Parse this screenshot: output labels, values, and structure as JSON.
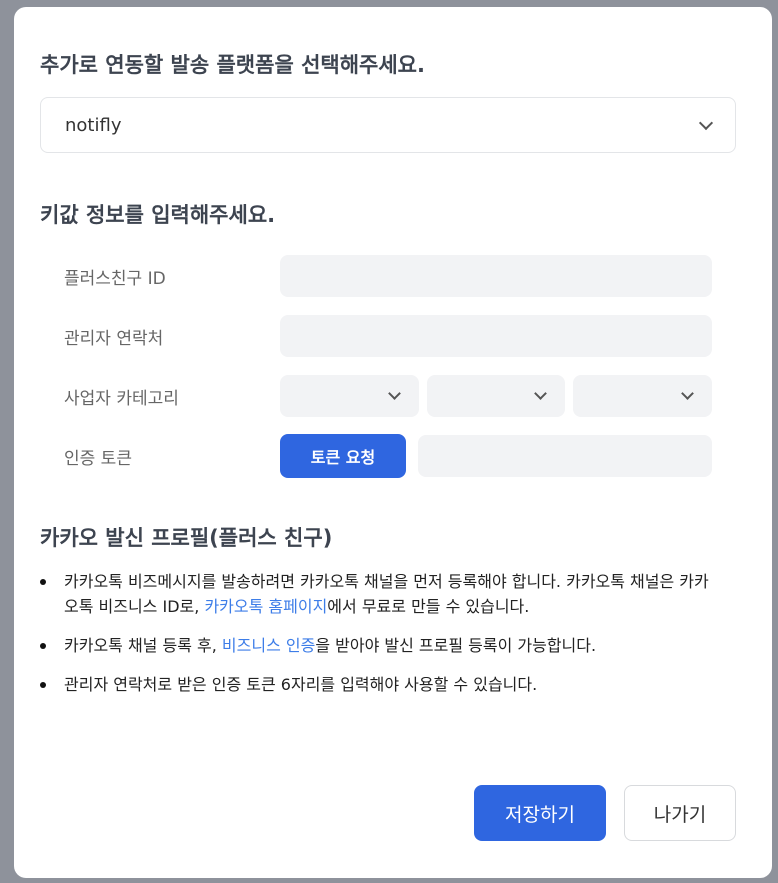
{
  "platform_section": {
    "title": "추가로 연동할 발송 플랫폼을 선택해주세요.",
    "selected": "notifly"
  },
  "key_section": {
    "title": "키값 정보를 입력해주세요.",
    "fields": [
      {
        "label": "플러스친구 ID",
        "value": ""
      },
      {
        "label": "관리자 연락처",
        "value": ""
      },
      {
        "label": "사업자 카테고리"
      },
      {
        "label": "인증 토큰",
        "value": ""
      }
    ],
    "token_button": "토큰 요청"
  },
  "profile_section": {
    "title": "카카오 발신 프로필(플러스 친구)",
    "items": [
      {
        "before": "카카오톡 비즈메시지를 발송하려면 카카오톡 채널을 먼저 등록해야 합니다. 카카오톡 채널은 카카오톡 비즈니스 ID로, ",
        "link": "카카오톡 홈페이지",
        "after": "에서 무료로 만들 수 있습니다."
      },
      {
        "before": "카카오톡 채널 등록 후, ",
        "link": "비즈니스 인증",
        "after": "을 받아야 발신 프로필 등록이 가능합니다."
      },
      {
        "before": "관리자 연락처로 받은 인증 토큰 6자리를 입력해야 사용할 수 있습니다."
      }
    ]
  },
  "buttons": {
    "save": "저장하기",
    "exit": "나가기"
  }
}
